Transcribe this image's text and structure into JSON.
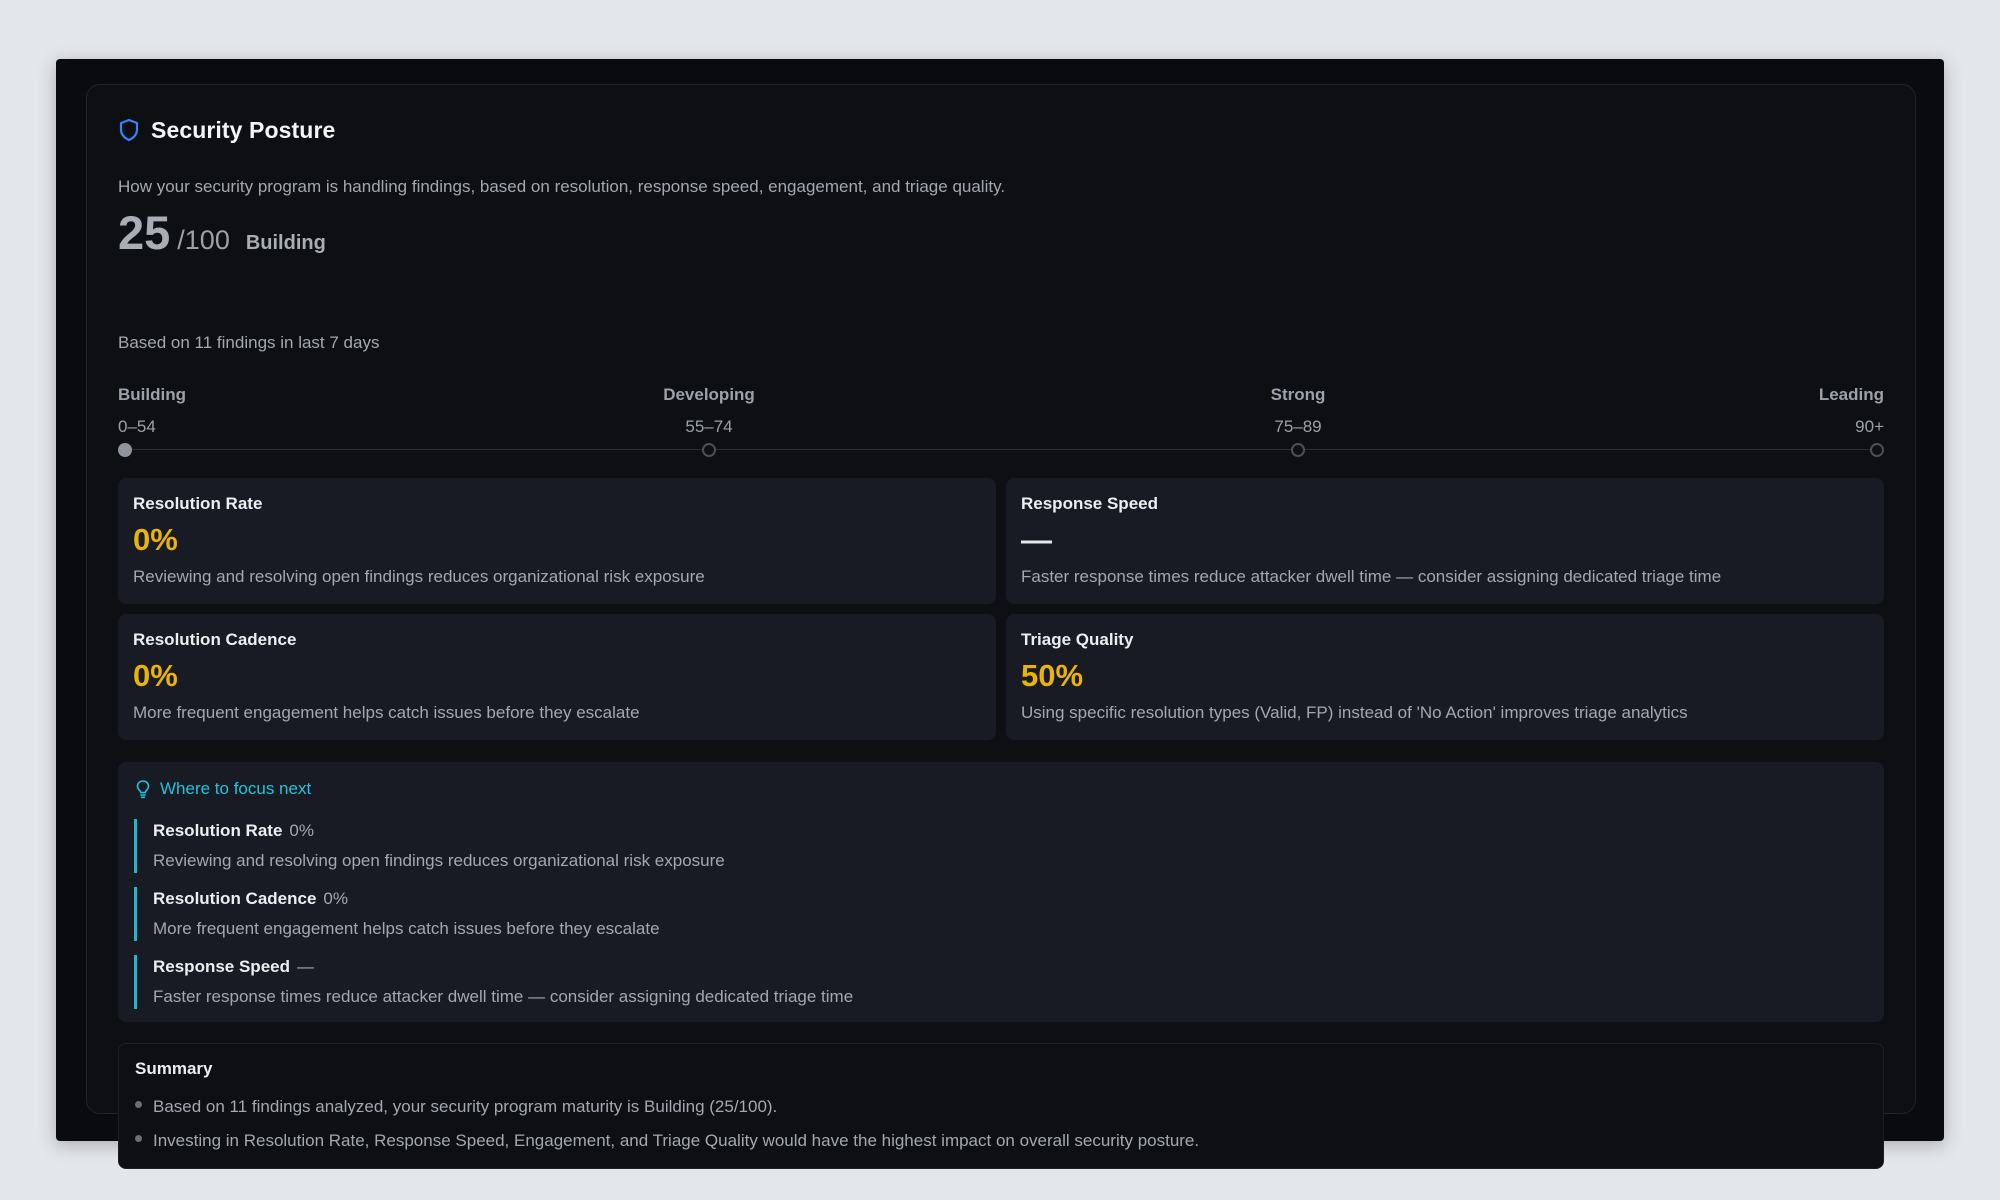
{
  "header": {
    "title": "Security Posture",
    "description": "How your security program is handling findings, based on resolution, response speed, engagement, and triage quality."
  },
  "score": {
    "value": "25",
    "max": "/100",
    "level": "Building",
    "based_on": "Based on 11 findings in last 7 days"
  },
  "scale": {
    "tiers": [
      {
        "name": "Building",
        "range": "0–54",
        "active": true
      },
      {
        "name": "Developing",
        "range": "55–74",
        "active": false
      },
      {
        "name": "Strong",
        "range": "75–89",
        "active": false
      },
      {
        "name": "Leading",
        "range": "90+",
        "active": false
      }
    ]
  },
  "metrics": [
    {
      "label": "Resolution Rate",
      "value": "0%",
      "hint": "Reviewing and resolving open findings reduces organizational risk exposure"
    },
    {
      "label": "Response Speed",
      "value": "—",
      "hint": "Faster response times reduce attacker dwell time — consider assigning dedicated triage time"
    },
    {
      "label": "Resolution Cadence",
      "value": "0%",
      "hint": "More frequent engagement helps catch issues before they escalate"
    },
    {
      "label": "Triage Quality",
      "value": "50%",
      "hint": "Using specific resolution types (Valid, FP) instead of 'No Action' improves triage analytics"
    }
  ],
  "focus": {
    "title": "Where to focus next",
    "items": [
      {
        "name": "Resolution Rate",
        "value": "0%",
        "hint": "Reviewing and resolving open findings reduces organizational risk exposure"
      },
      {
        "name": "Resolution Cadence",
        "value": "0%",
        "hint": "More frequent engagement helps catch issues before they escalate"
      },
      {
        "name": "Response Speed",
        "value": "—",
        "hint": "Faster response times reduce attacker dwell time — consider assigning dedicated triage time"
      }
    ]
  },
  "summary": {
    "title": "Summary",
    "items": [
      "Based on 11 findings analyzed, your security program maturity is Building (25/100).",
      "Investing in Resolution Rate, Response Speed, Engagement, and Triage Quality would have the highest impact on overall security posture."
    ]
  },
  "colors": {
    "accent_blue": "#3b82f6",
    "accent_cyan": "#22c3dc",
    "metric_value": "#eab308",
    "background": "#0a0b0e",
    "card": "#181b23"
  },
  "icons": {
    "title": "shield-icon",
    "focus": "lightbulb-icon"
  }
}
